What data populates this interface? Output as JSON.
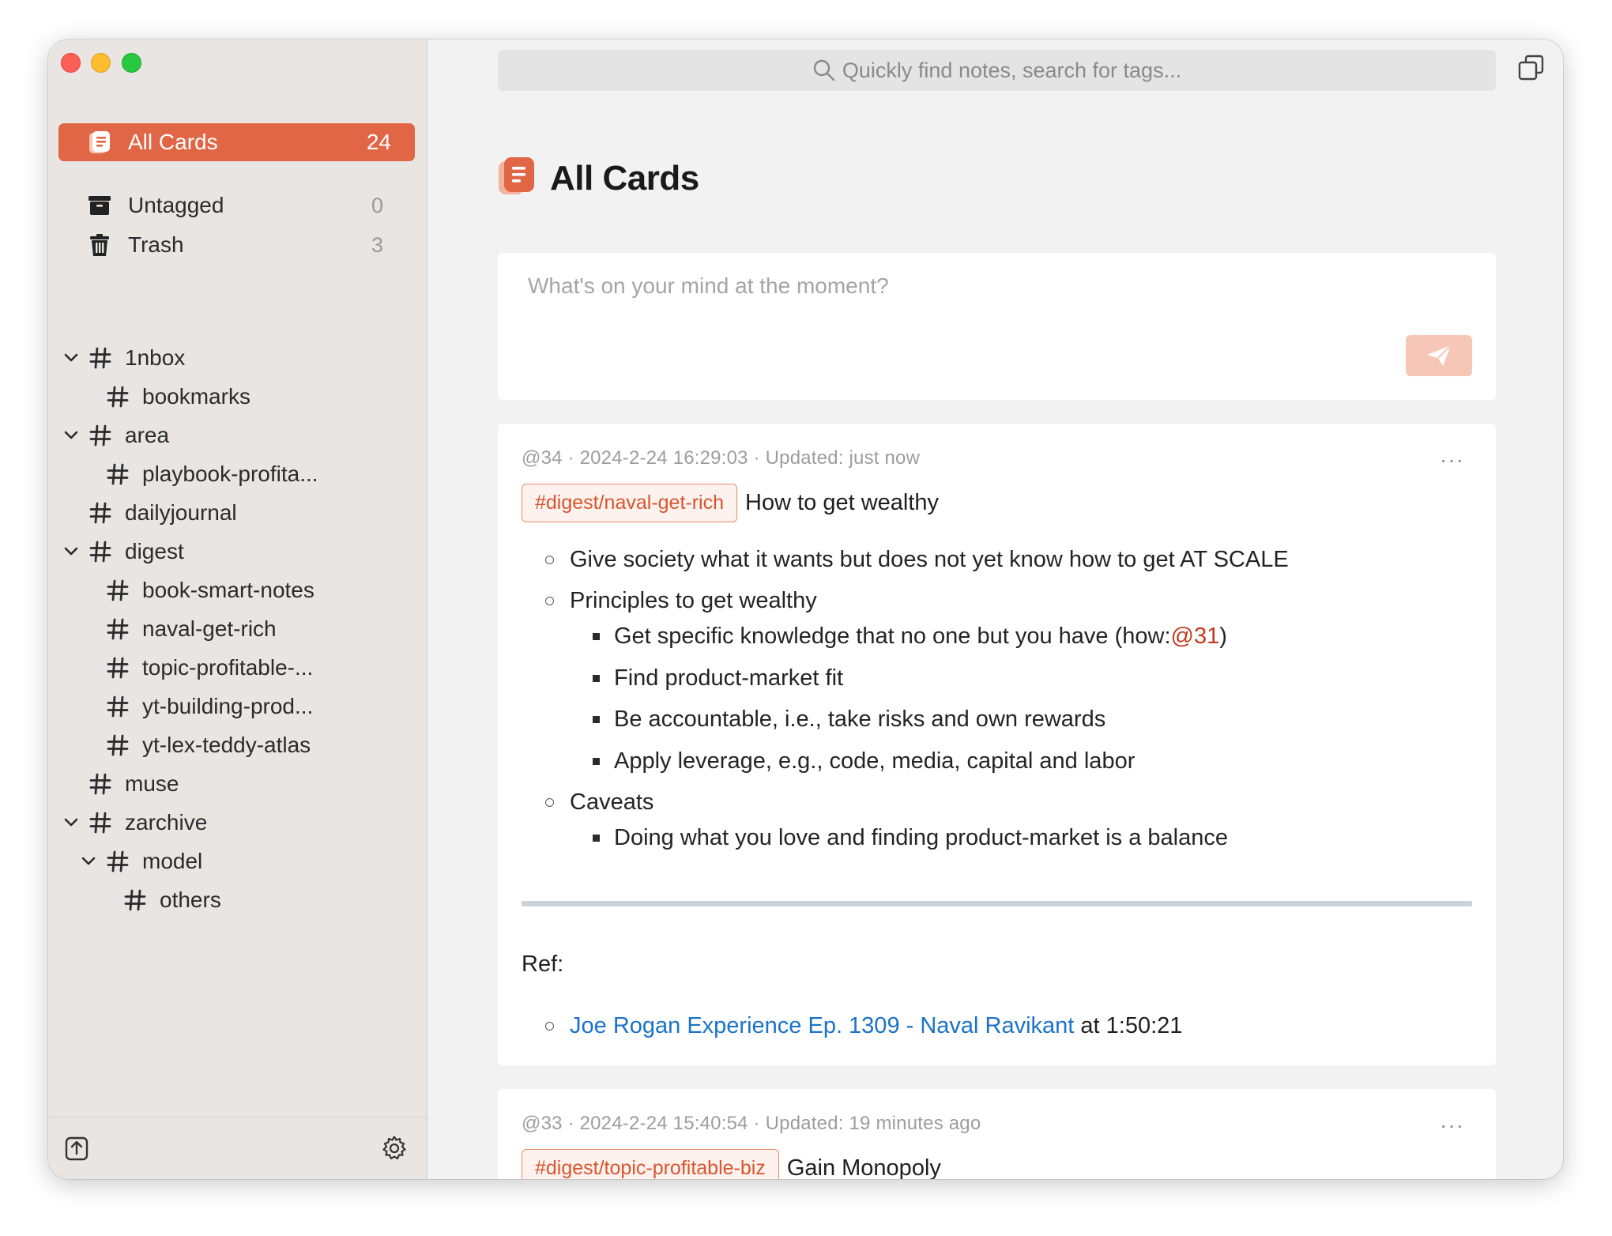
{
  "search": {
    "placeholder": "Quickly find notes, search for tags..."
  },
  "sidebar": {
    "all_cards": {
      "label": "All Cards",
      "count": "24"
    },
    "untagged": {
      "label": "Untagged",
      "count": "0"
    },
    "trash": {
      "label": "Trash",
      "count": "3"
    },
    "tags": [
      {
        "label": "1nbox",
        "expanded": true
      },
      {
        "label": "bookmarks"
      },
      {
        "label": "area",
        "expanded": true
      },
      {
        "label": "playbook-profita..."
      },
      {
        "label": "dailyjournal"
      },
      {
        "label": "digest",
        "expanded": true
      },
      {
        "label": "book-smart-notes"
      },
      {
        "label": "naval-get-rich"
      },
      {
        "label": "topic-profitable-..."
      },
      {
        "label": "yt-building-prod..."
      },
      {
        "label": "yt-lex-teddy-atlas"
      },
      {
        "label": "muse"
      },
      {
        "label": "zarchive",
        "expanded": true
      },
      {
        "label": "model",
        "expanded": true
      },
      {
        "label": "others"
      }
    ]
  },
  "main": {
    "title": "All Cards",
    "composer": {
      "placeholder": "What's on your mind at the moment?"
    },
    "cards": [
      {
        "meta": "@34 · 2024-2-24 16:29:03 · Updated: just now",
        "tag": "#digest/naval-get-rich",
        "title": "How to get wealthy",
        "items": [
          "Give society what it wants but does not yet know how to get AT SCALE",
          "Principles to get wealthy",
          "Get specific knowledge that no one but you have (how: ",
          "@31",
          " )",
          "Find product-market fit",
          "Be accountable, i.e., take risks and own rewards",
          "Apply leverage, e.g., code, media, capital and labor",
          "Caveats",
          "Doing what you love and finding product-market is a balance"
        ],
        "ref_label": "Ref:",
        "ref_link": "Joe Rogan Experience Ep. 1309 - Naval Ravikant",
        "ref_suffix": " at 1:50:21"
      },
      {
        "meta": "@33 · 2024-2-24 15:40:54 · Updated: 19 minutes ago",
        "tag": "#digest/topic-profitable-biz",
        "title": "Gain Monopoly"
      }
    ]
  },
  "more_glyph": "···",
  "colors": {
    "accent": "#e06645",
    "link": "#1a73c8",
    "mention": "#c23a1e"
  }
}
